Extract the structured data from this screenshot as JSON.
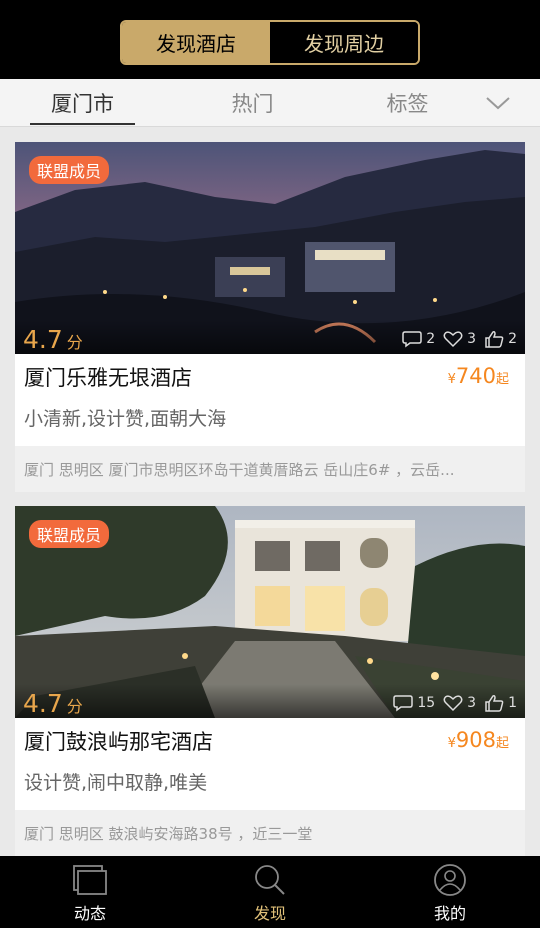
{
  "header": {
    "segments": [
      {
        "label": "发现酒店",
        "active": true
      },
      {
        "label": "发现周边",
        "active": false
      }
    ]
  },
  "tabs": [
    {
      "label": "厦门市",
      "active": true
    },
    {
      "label": "热门",
      "active": false
    },
    {
      "label": "标签",
      "active": false
    }
  ],
  "tabs_more_icon": "chevron-down-icon",
  "hotels": [
    {
      "badge": "联盟成员",
      "rating": "4.7",
      "rating_unit": "分",
      "comments": "2",
      "favorites": "3",
      "likes": "2",
      "name": "厦门乐雅无垠酒店",
      "price_symbol": "¥",
      "price": "740",
      "price_unit": "起",
      "tags": "小清新,设计赞,面朝大海",
      "address": "厦门 思明区 厦门市思明区环岛干道黄厝路云 岳山庄6# ，云岳..."
    },
    {
      "badge": "联盟成员",
      "rating": "4.7",
      "rating_unit": "分",
      "comments": "15",
      "favorites": "3",
      "likes": "1",
      "name": "厦门鼓浪屿那宅酒店",
      "price_symbol": "¥",
      "price": "908",
      "price_unit": "起",
      "tags": "设计赞,闹中取静,唯美",
      "address": "厦门 思明区 鼓浪屿安海路38号 ，近三一堂"
    }
  ],
  "bottom_nav": [
    {
      "label": "动态",
      "icon": "feed-icon",
      "active": false
    },
    {
      "label": "发现",
      "icon": "search-icon",
      "active": true
    },
    {
      "label": "我的",
      "icon": "user-icon",
      "active": false
    }
  ],
  "colors": {
    "accent_gold": "#c9a96a",
    "price_orange": "#f5871f",
    "badge_orange": "#f26a3c",
    "rating_orange": "#e8a64c"
  }
}
